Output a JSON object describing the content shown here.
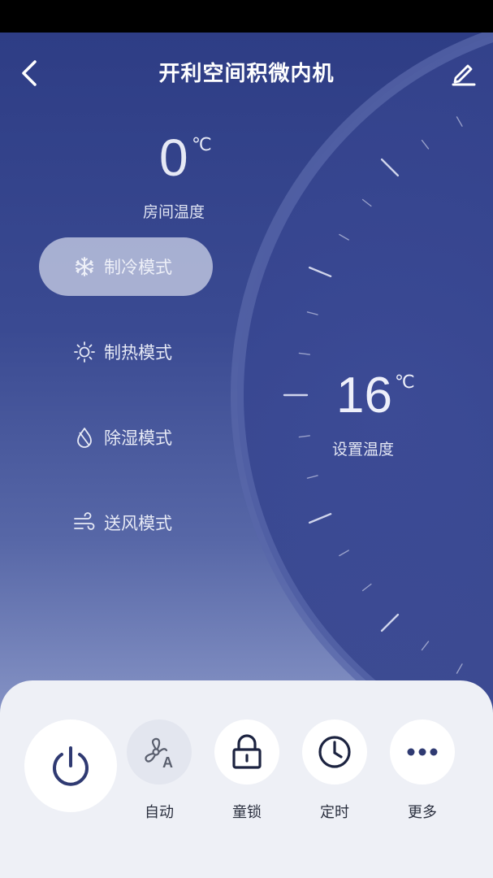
{
  "header": {
    "title": "开利空间积微内机"
  },
  "room": {
    "temperature": "0",
    "unit": "℃",
    "label": "房间温度"
  },
  "modes": [
    {
      "label": "制冷模式",
      "icon": "snowflake-icon",
      "active": true
    },
    {
      "label": "制热模式",
      "icon": "sun-icon",
      "active": false
    },
    {
      "label": "除湿模式",
      "icon": "droplet-icon",
      "active": false
    },
    {
      "label": "送风模式",
      "icon": "wind-icon",
      "active": false
    }
  ],
  "setpoint": {
    "temperature": "16",
    "unit": "℃",
    "label": "设置温度"
  },
  "controls": [
    {
      "label": "自动",
      "icon": "fan-auto-icon"
    },
    {
      "label": "童锁",
      "icon": "lock-icon"
    },
    {
      "label": "定时",
      "icon": "clock-icon"
    },
    {
      "label": "更多",
      "icon": "more-icon"
    }
  ],
  "colors": {
    "accent": "#2e3d85",
    "panel": "#eef0f6",
    "icon_dark": "#1c2340"
  }
}
